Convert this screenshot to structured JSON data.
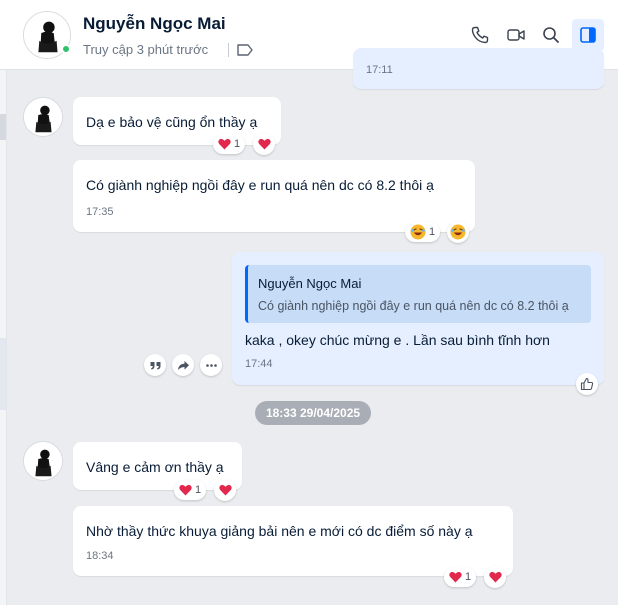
{
  "header": {
    "contact_name": "Nguyễn Ngọc Mai",
    "last_seen": "Truy cập 3 phút trước",
    "icons": [
      "phone-icon",
      "video-call-icon",
      "search-icon",
      "sidebar-toggle-icon"
    ]
  },
  "colors": {
    "accent": "#0068ff",
    "my_bubble": "#e5efff",
    "quote_bg": "#c7dcf7",
    "online": "#2fc26b",
    "heart": "#e2284d"
  },
  "messages": {
    "m0": {
      "time": "17:11"
    },
    "m1": {
      "text": "Dạ e bảo vệ cũng ổn thầy ạ",
      "reaction_count": "1"
    },
    "m2": {
      "text": "Có giành nghiệp ngồi đây e run quá nên dc có 8.2 thôi ạ",
      "time": "17:35",
      "reaction_count": "1"
    },
    "m3": {
      "quote_name": "Nguyễn Ngọc Mai",
      "quote_text": "Có giành nghiệp ngồi đây e run quá nên dc có 8.2 thôi ạ",
      "text": "kaka , okey chúc mừng e . Lần sau bình tĩnh hơn",
      "time": "17:44"
    },
    "date_divider": "18:33 29/04/2025",
    "m4": {
      "text": "Vâng e cảm ơn thầy ạ",
      "reaction_count": "1"
    },
    "m5": {
      "text": "Nhờ thầy thức khuya giảng bải nên e mới có dc điểm số này ạ",
      "time": "18:34",
      "reaction_count": "1"
    }
  }
}
